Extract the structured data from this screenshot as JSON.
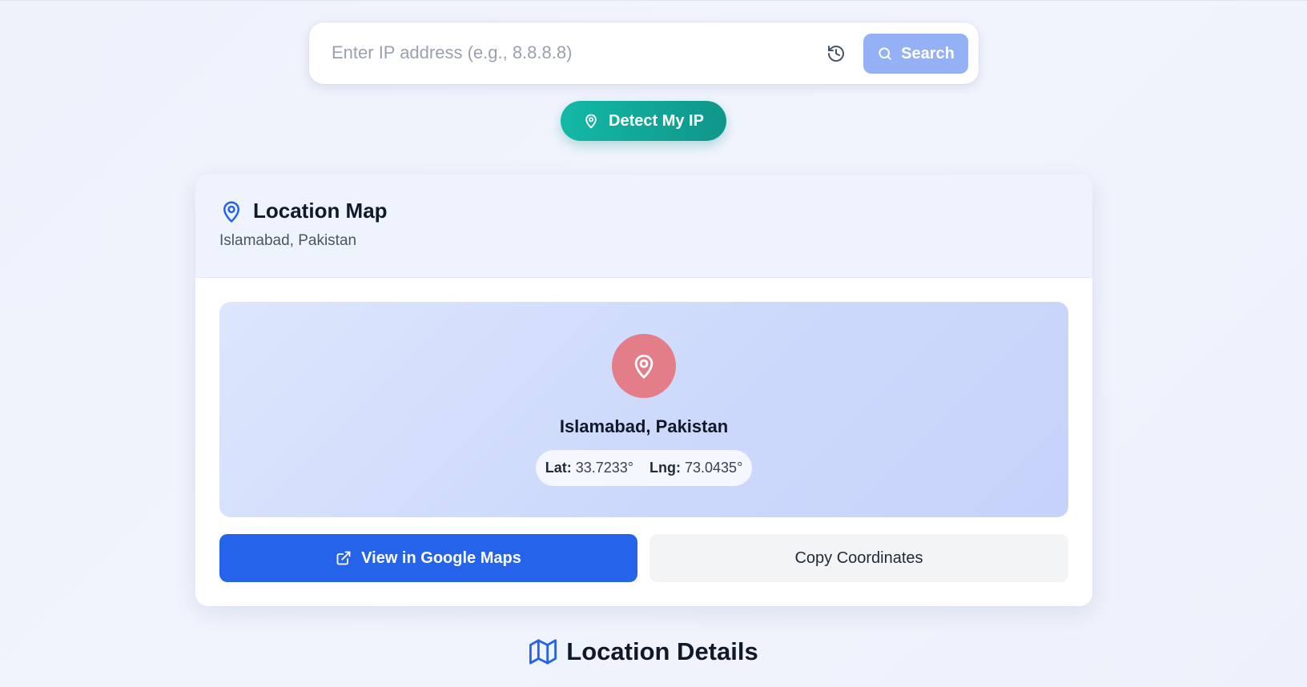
{
  "search": {
    "placeholder": "Enter IP address (e.g., 8.8.8.8)",
    "value": "",
    "button_label": "Search",
    "history_icon": "history-icon",
    "search_icon": "search-icon"
  },
  "detect": {
    "label": "Detect My IP",
    "icon": "map-pin-icon"
  },
  "location_map": {
    "title": "Location Map",
    "subtitle": "Islamabad, Pakistan",
    "city": "Islamabad, Pakistan",
    "lat_label": "Lat:",
    "lat_value": "33.7233°",
    "lng_label": "Lng:",
    "lng_value": "73.0435°",
    "google_maps_label": "View in Google Maps",
    "copy_label": "Copy Coordinates"
  },
  "details": {
    "title": "Location Details",
    "icon": "map-icon"
  },
  "colors": {
    "primary": "#2563eb",
    "search_button": "#94b1f5",
    "detect_button": "#14b8a6",
    "pin_circle": "#e37d88"
  }
}
